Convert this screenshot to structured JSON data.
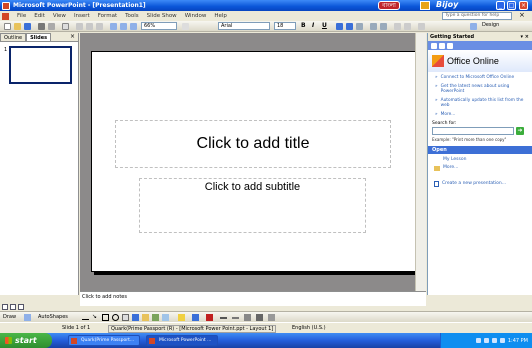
{
  "window": {
    "title": "Microsoft PowerPoint - [Presentation1]",
    "lang_pill": "বাংলা",
    "brand": "Bijoy"
  },
  "menu": {
    "items": [
      "File",
      "Edit",
      "View",
      "Insert",
      "Format",
      "Tools",
      "Slide Show",
      "Window",
      "Help"
    ],
    "help_placeholder": "Type a question for help"
  },
  "toolbar": {
    "zoom": "66%",
    "font": "Arial",
    "font_size": "18",
    "bold": "B",
    "italic": "I",
    "underline": "U",
    "design_label": "Design"
  },
  "outline_pane": {
    "tabs": [
      "Outline",
      "Slides"
    ],
    "slide_number": "1"
  },
  "slide": {
    "title_placeholder": "Click to add title",
    "subtitle_placeholder": "Click to add subtitle"
  },
  "notes": {
    "placeholder": "Click to add notes"
  },
  "task_pane": {
    "header": "Getting Started",
    "brand": "Office Online",
    "links": [
      "Connect to Microsoft Office Online",
      "Get the latest news about using PowerPoint",
      "Automatically update this list from the web"
    ],
    "more_label": "More...",
    "search_label": "Search for:",
    "example": "Example: \"Print more than one copy\"",
    "open_section": "Open",
    "open_files": [
      "My Lesson",
      "More..."
    ],
    "create_new": "Create a new presentation..."
  },
  "drawbar": {
    "draw_label": "Draw",
    "autoshapes_label": "AutoShapes"
  },
  "statusbar": {
    "slide_of": "Slide 1 of 1",
    "design_template": "Quark(Prime Passport (R) - [Microsoft Power Point.ppt - Layout 1]",
    "language": "English (U.S.)"
  },
  "taskbar": {
    "start_label": "start",
    "buttons": [
      "Quark(Prime Passport...",
      "Microsoft PowerPoint ..."
    ],
    "clock": "1:47 PM"
  }
}
